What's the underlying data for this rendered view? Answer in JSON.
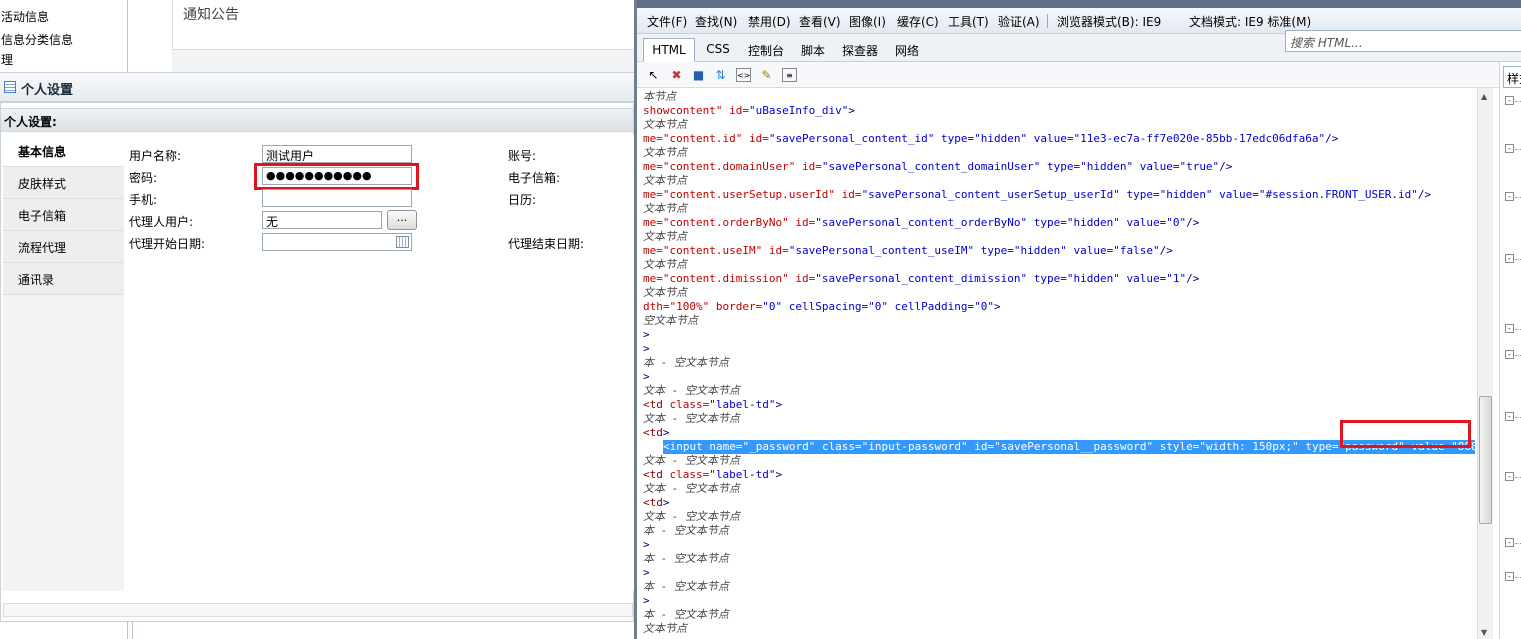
{
  "app": {
    "top_menu": [
      "活动信息",
      "信息分类信息",
      "理"
    ],
    "notice_title": "通知公告",
    "panel_title": "个人设置",
    "section_title": "个人设置:",
    "tabs": [
      "基本信息",
      "皮肤样式",
      "电子信箱",
      "流程代理",
      "通讯录"
    ],
    "form": {
      "username_label": "用户名称:",
      "username_value": "测试用户",
      "password_label": "密码:",
      "password_value": "●●●●●●●●●●●",
      "phone_label": "手机:",
      "proxy_user_label": "代理人用户:",
      "proxy_user_value": "无",
      "proxy_button": "...",
      "proxy_start_label": "代理开始日期:",
      "account_label": "账号:",
      "email_label": "电子信箱:",
      "calendar_label": "日历:",
      "proxy_end_label": "代理结束日期:"
    }
  },
  "devtools": {
    "menu": [
      "文件(F)",
      "查找(N)",
      "禁用(D)",
      "查看(V)",
      "图像(I)",
      "缓存(C)",
      "工具(T)",
      "验证(A)",
      "浏览器模式(B): IE9",
      "文档模式: IE9 标准(M)"
    ],
    "tabs": [
      "HTML",
      "CSS",
      "控制台",
      "脚本",
      "探查器",
      "网络"
    ],
    "search_placeholder": "搜索 HTML...",
    "right_tab": "样式",
    "lines": [
      {
        "t": "txt",
        "s": "本节点"
      },
      {
        "t": "attr",
        "a": "showcontent\"",
        "b": " id=",
        "c": "\"uBaseInfo_div\"",
        "d": ">"
      },
      {
        "t": "txt",
        "s": "文本节点"
      },
      {
        "t": "attr",
        "a": "me=\"content.id\"",
        "b": " id=",
        "c": "\"savePersonal_content_id\" type=\"hidden\" value=\"11e3-ec7a-ff7e020e-85bb-17edc06dfa6a\"",
        "d": "/>"
      },
      {
        "t": "txt",
        "s": "文本节点"
      },
      {
        "t": "attr",
        "a": "me=\"content.domainUser\"",
        "b": " id=",
        "c": "\"savePersonal_content_domainUser\" type=\"hidden\" value=\"true\"",
        "d": "/>"
      },
      {
        "t": "txt",
        "s": "文本节点"
      },
      {
        "t": "attr",
        "a": "me=\"content.userSetup.userId\"",
        "b": " id=",
        "c": "\"savePersonal_content_userSetup_userId\" type=\"hidden\" value=\"#session.FRONT_USER.id\"",
        "d": "/>"
      },
      {
        "t": "txt",
        "s": "文本节点"
      },
      {
        "t": "attr",
        "a": "me=\"content.orderByNo\"",
        "b": " id=",
        "c": "\"savePersonal_content_orderByNo\" type=\"hidden\" value=\"0\"",
        "d": "/>"
      },
      {
        "t": "txt",
        "s": "文本节点"
      },
      {
        "t": "attr",
        "a": "me=\"content.useIM\"",
        "b": " id=",
        "c": "\"savePersonal_content_useIM\" type=\"hidden\" value=\"false\"",
        "d": "/>"
      },
      {
        "t": "txt",
        "s": "文本节点"
      },
      {
        "t": "attr",
        "a": "me=\"content.dimission\"",
        "b": " id=",
        "c": "\"savePersonal_content_dimission\" type=\"hidden\" value=\"1\"",
        "d": "/>"
      },
      {
        "t": "txt",
        "s": "文本节点"
      },
      {
        "t": "attr",
        "a": "dth=\"100%\"",
        "b": " border=",
        "c": "\"0\" cellSpacing=\"0\" cellPadding=\"0\"",
        "d": ">"
      },
      {
        "t": "txt",
        "s": " 空文本节点"
      },
      {
        "t": "punc",
        "s": ">"
      },
      {
        "t": "punc",
        "s": ">"
      },
      {
        "t": "txt",
        "s": "本 - 空文本节点"
      },
      {
        "t": "punc",
        "s": ">"
      },
      {
        "t": "txt",
        "s": " 文本 - 空文本节点"
      },
      {
        "t": "tag",
        "a": " <td",
        "b": " class=",
        "c": "\"label-td\"",
        "d": ">"
      },
      {
        "t": "txt",
        "s": " 文本 - 空文本节点"
      },
      {
        "t": "tag",
        "a": " <td",
        "b": "",
        "c": "",
        "d": ">"
      },
      {
        "t": "sel",
        "s": "<input name=\"_password\" class=\"input-password\" id=\"savePersonal__password\" style=\"width: 150px;\" type=\"password\" value=\"888888qqqq\"/>"
      },
      {
        "t": "txt",
        "s": " 文本 - 空文本节点"
      },
      {
        "t": "tag",
        "a": " <td",
        "b": " class=",
        "c": "\"label-td\"",
        "d": ">"
      },
      {
        "t": "txt",
        "s": " 文本 - 空文本节点"
      },
      {
        "t": "tag",
        "a": " <td",
        "b": "",
        "c": "",
        "d": ">"
      },
      {
        "t": "txt",
        "s": " 文本 - 空文本节点"
      },
      {
        "t": "txt",
        "s": "本 - 空文本节点"
      },
      {
        "t": "punc",
        "s": ">"
      },
      {
        "t": "txt",
        "s": "本 - 空文本节点"
      },
      {
        "t": "punc",
        "s": ">"
      },
      {
        "t": "txt",
        "s": "本 - 空文本节点"
      },
      {
        "t": "punc",
        "s": ">"
      },
      {
        "t": "txt",
        "s": "本 - 空文本节点"
      },
      {
        "t": "txt",
        "s": "文本节点"
      }
    ]
  }
}
